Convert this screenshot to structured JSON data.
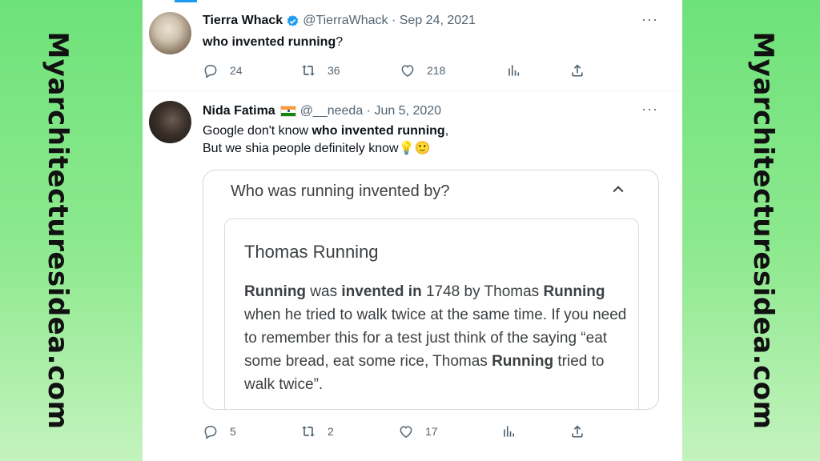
{
  "watermark": "Myarchitecturesidea.com",
  "tweets": [
    {
      "display_name": "Tierra Whack",
      "handle": "@TierraWhack",
      "date": "Sep 24, 2021",
      "verified": true,
      "body_bold": "who invented running",
      "body_rest": "?",
      "more": "···",
      "replies": "24",
      "retweets": "36",
      "likes": "218"
    },
    {
      "display_name": "Nida Fatima",
      "flag_emoji": "india-flag",
      "handle": "@__needa",
      "date": "Jun 5, 2020",
      "line1_pre": "Google don't know ",
      "line1_bold": "who invented running",
      "line1_post": ",",
      "line2": "But we shia people definitely know",
      "emojis": "💡🙂",
      "more": "···",
      "replies": "5",
      "retweets": "2",
      "likes": "17"
    }
  ],
  "embed": {
    "question": "Who was running invented by?",
    "answer_title": "Thomas Running",
    "answer": {
      "w1": "Running",
      "t1": " was ",
      "w2": "invented in",
      "t2": " 1748 by Thomas ",
      "w3": "Running",
      "t3": " when he tried to walk twice at the same time. If you need to remember this for a test just think of the saying “eat some bread, eat some rice, Thomas ",
      "w4": "Running",
      "t4": " tried to walk twice”."
    }
  },
  "colors": {
    "accent": "#1d9bf0",
    "side_green": "#6ee27a",
    "meta_gray": "#536471"
  }
}
